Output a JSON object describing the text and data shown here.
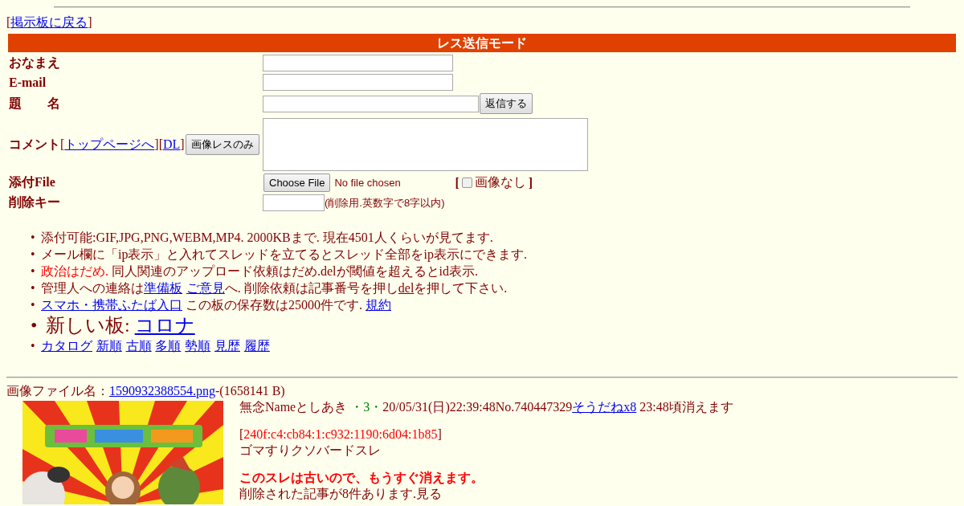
{
  "back_link": {
    "open": "[",
    "label": "掲示板に戻る",
    "close": "]"
  },
  "form": {
    "title": "レス送信モード",
    "rows": [
      {
        "kind": "text",
        "label": "おなまえ"
      },
      {
        "kind": "text",
        "label": "E-mail"
      },
      {
        "kind": "submit",
        "label": "題　　名",
        "button": "返信する"
      },
      {
        "kind": "comment",
        "label": "コメント",
        "links": [
          {
            "open": "[",
            "label": "トップページへ",
            "close": "]"
          },
          {
            "open": "[",
            "label": "DL",
            "close": "]"
          }
        ],
        "button": "画像レスのみ"
      },
      {
        "kind": "file",
        "label": "添付File",
        "button": "Choose File",
        "status": "No file chosen",
        "open": "[",
        "checked": false,
        "option": "画像なし",
        "close": "]"
      },
      {
        "kind": "key",
        "label": "削除キー",
        "hint": "(削除用.英数字で8字以内)"
      }
    ]
  },
  "notices": [
    {
      "bullet": "•",
      "large": false,
      "parts": [
        {
          "kind": "text",
          "text": "添付可能:GIF,JPG,PNG,WEBM,MP4. 2000KBまで. 現在4501人くらいが見てます."
        }
      ]
    },
    {
      "bullet": "•",
      "large": false,
      "parts": [
        {
          "kind": "text",
          "text": "メール欄に「ip表示」と入れてスレッドを立てるとスレッド全部をip表示にできます."
        }
      ]
    },
    {
      "bullet": "•",
      "large": false,
      "parts": [
        {
          "kind": "red",
          "text": "政治はだめ."
        },
        {
          "kind": "text",
          "text": " 同人関連のアップロード依頼はだめ.delが閾値を超えるとid表示."
        }
      ]
    },
    {
      "bullet": "•",
      "large": false,
      "parts": [
        {
          "kind": "text",
          "text": "管理人への連絡は"
        },
        {
          "kind": "link",
          "text": "準備板",
          "space_after": true
        },
        {
          "kind": "link",
          "text": "ご意見"
        },
        {
          "kind": "text",
          "text": "へ. 削除依頼は記事番号を押し"
        },
        {
          "kind": "dark_link",
          "text": "del"
        },
        {
          "kind": "text",
          "text": "を押して下さい."
        }
      ]
    },
    {
      "bullet": "•",
      "large": false,
      "parts": [
        {
          "kind": "link",
          "text": "スマホ・携帯ふたば入口"
        },
        {
          "kind": "text",
          "text": " この板の保存数は25000件です. "
        },
        {
          "kind": "link",
          "text": "規約"
        }
      ]
    },
    {
      "bullet": "•",
      "large": true,
      "parts": [
        {
          "kind": "text",
          "text": "新しい板: "
        },
        {
          "kind": "link",
          "text": "コロナ"
        }
      ]
    },
    {
      "bullet": "•",
      "large": false,
      "parts": [
        {
          "kind": "link",
          "text": "カタログ",
          "space_after": true
        },
        {
          "kind": "link",
          "text": "新順",
          "space_after": true
        },
        {
          "kind": "link",
          "text": "古順",
          "space_after": true
        },
        {
          "kind": "link",
          "text": "多順",
          "space_after": true
        },
        {
          "kind": "link",
          "text": "勢順",
          "space_after": true
        },
        {
          "kind": "link",
          "text": "見歴",
          "space_after": true
        },
        {
          "kind": "link",
          "text": "履歴"
        }
      ]
    }
  ],
  "post": {
    "file_line": [
      {
        "kind": "text",
        "text": "画像ファイル名："
      },
      {
        "kind": "link",
        "text": "1590932388554.png"
      },
      {
        "kind": "text",
        "text": "-(1658141 B)"
      }
    ],
    "header": [
      {
        "kind": "text",
        "text": "無念Nameとしあき "
      },
      {
        "kind": "green",
        "text": "・3・"
      },
      {
        "kind": "text",
        "text": "20/05/31(日)22:39:48No.740447329"
      },
      {
        "kind": "link",
        "text": "そうだねx8"
      },
      {
        "kind": "text",
        "text": " 23:48頃消えます"
      }
    ],
    "ip": [
      {
        "kind": "text",
        "text": "["
      },
      {
        "kind": "red",
        "text": "240f:c4:cb84:1:c932:1190:6d04:1b85"
      },
      {
        "kind": "text",
        "text": "]"
      }
    ],
    "body": "ゴマすりクソバードスレ",
    "warning": "このスレは古いので、もうすぐ消えます。",
    "deleted_note": "削除された記事が8件あります.見る"
  }
}
